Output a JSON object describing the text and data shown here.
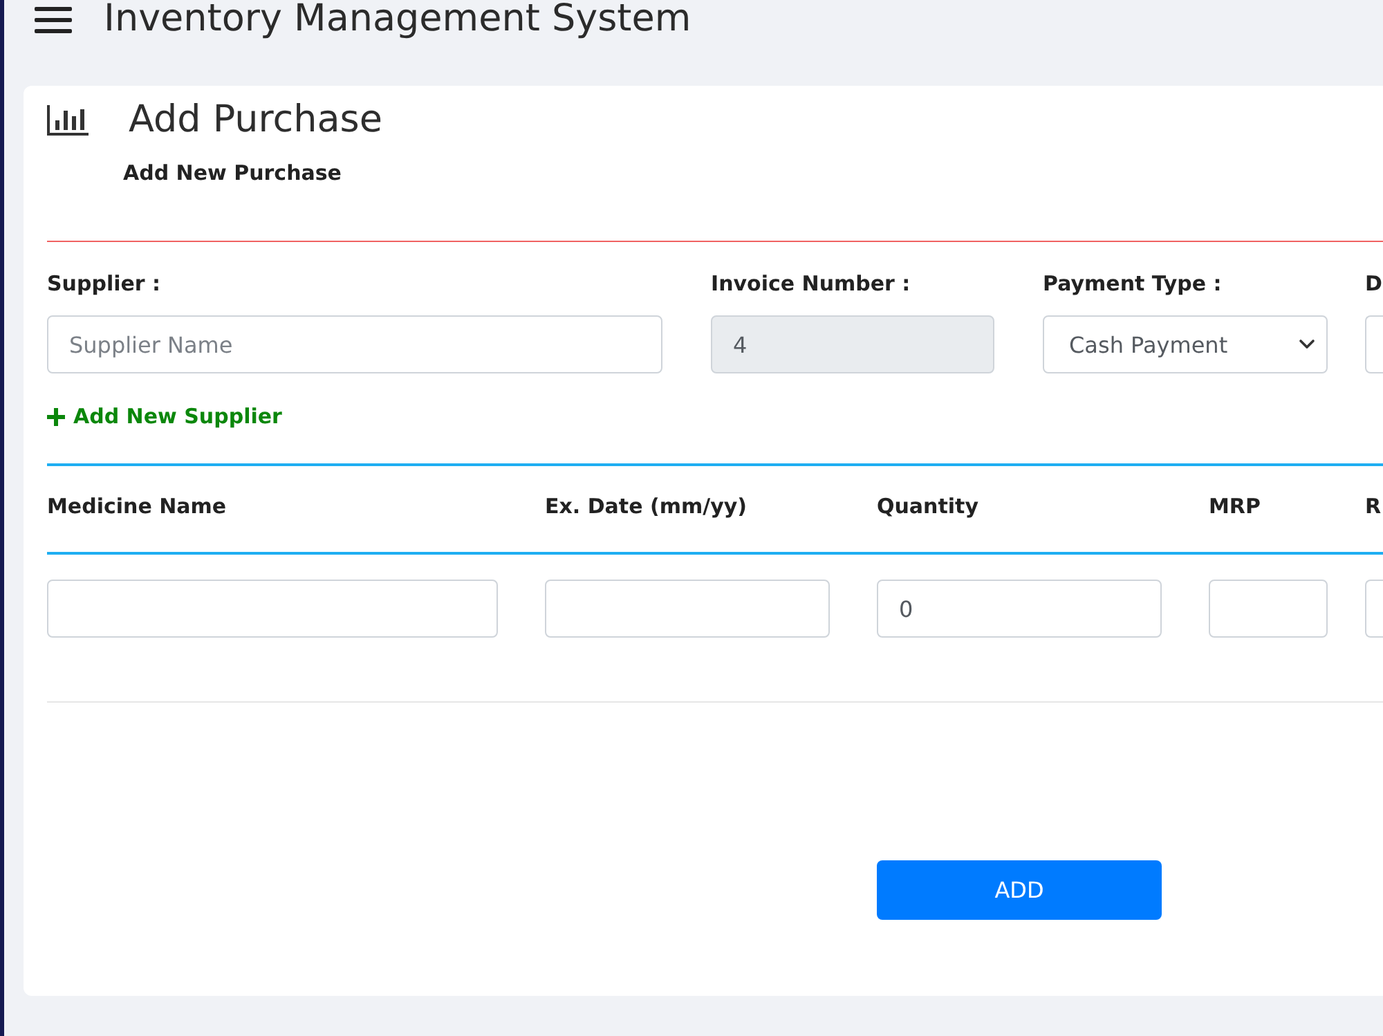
{
  "header": {
    "title": "Inventory Management System"
  },
  "page": {
    "title": "Add Purchase",
    "subtitle": "Add New Purchase"
  },
  "supplier_fields": [
    {
      "kind": "input",
      "label": "Supplier :",
      "placeholder": "Supplier Name",
      "readonly": false
    },
    {
      "kind": "input",
      "label": "Invoice Number :",
      "value": "4",
      "readonly": true
    },
    {
      "kind": "select",
      "label": "Payment Type :",
      "value": "Cash Payment",
      "readonly": false
    },
    {
      "kind": "input",
      "label": "D",
      "readonly": false
    }
  ],
  "add_supplier_link": {
    "label": "Add New Supplier"
  },
  "medicine_table": {
    "columns": [
      "Medicine Name",
      "Ex. Date (mm/yy)",
      "Quantity",
      "MRP",
      "R"
    ],
    "rows": [
      {
        "cells": [
          {},
          {},
          {
            "value": "0"
          },
          {},
          {}
        ]
      }
    ]
  },
  "submit_button": {
    "label": "ADD"
  }
}
